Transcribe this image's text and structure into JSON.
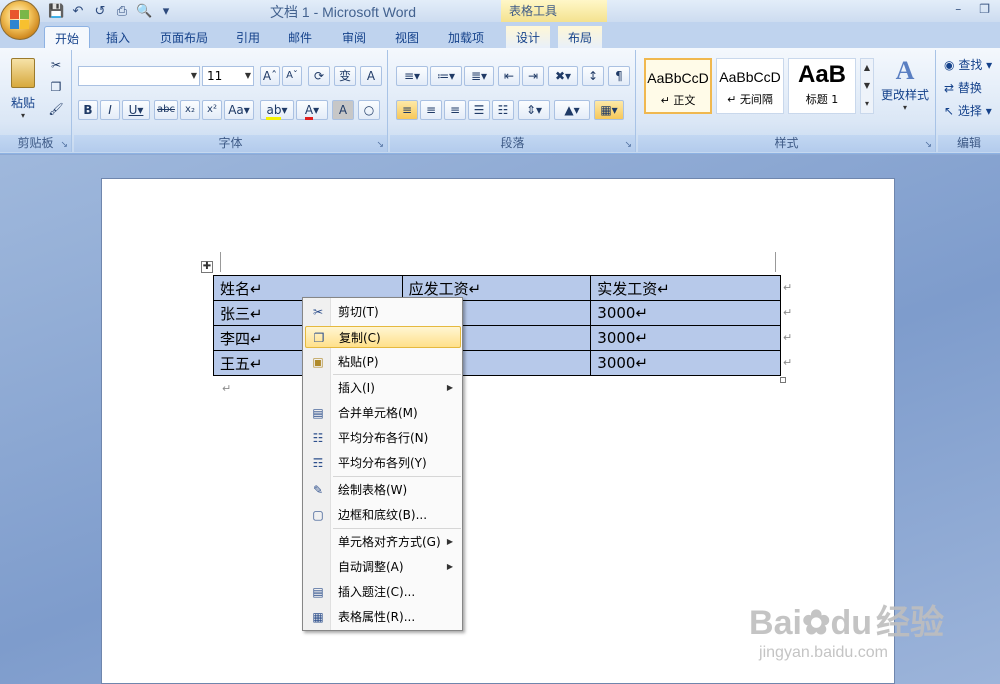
{
  "window": {
    "title": "文档 1 - Microsoft Word",
    "context_tab_group": "表格工具"
  },
  "quick_access": [
    "save-icon",
    "undo-icon",
    "redo-icon",
    "print-icon",
    "print-preview-icon",
    "customize-icon"
  ],
  "tabs": [
    {
      "label": "开始",
      "active": true
    },
    {
      "label": "插入"
    },
    {
      "label": "页面布局"
    },
    {
      "label": "引用"
    },
    {
      "label": "邮件"
    },
    {
      "label": "审阅"
    },
    {
      "label": "视图"
    },
    {
      "label": "加载项"
    },
    {
      "label": "设计"
    },
    {
      "label": "布局"
    }
  ],
  "ribbon": {
    "clipboard": {
      "label": "剪贴板",
      "paste": "粘贴"
    },
    "font": {
      "label": "字体",
      "font_name": "",
      "font_size": "11"
    },
    "paragraph": {
      "label": "段落"
    },
    "styles": {
      "label": "样式",
      "items": [
        {
          "sample": "AaBbCcD",
          "name": "↵ 正文"
        },
        {
          "sample": "AaBbCcD",
          "name": "↵ 无间隔"
        },
        {
          "sample": "AaB",
          "name": "标题 1"
        }
      ],
      "change_styles": "更改样式"
    },
    "editing": {
      "label": "编辑",
      "find": "查找",
      "replace": "替换",
      "select": "选择"
    }
  },
  "table": {
    "headers": [
      "姓名↵",
      "应发工资↵",
      "实发工资↵"
    ],
    "rows": [
      [
        "张三↵",
        "",
        "3000↵"
      ],
      [
        "李四↵",
        "",
        "3000↵"
      ],
      [
        "王五↵",
        "",
        "3000↵"
      ]
    ]
  },
  "context_menu": {
    "items": [
      {
        "label": "剪切(T)",
        "icon": "scissors-icon"
      },
      {
        "label": "复制(C)",
        "icon": "copy-icon",
        "highlighted": true
      },
      {
        "label": "粘贴(P)",
        "icon": "paste-icon"
      },
      {
        "label": "插入(I)",
        "submenu": true
      },
      {
        "label": "合并单元格(M)",
        "icon": "merge-cells-icon"
      },
      {
        "label": "平均分布各行(N)",
        "icon": "distribute-rows-icon"
      },
      {
        "label": "平均分布各列(Y)",
        "icon": "distribute-columns-icon"
      },
      {
        "label": "绘制表格(W)",
        "icon": "draw-table-icon"
      },
      {
        "label": "边框和底纹(B)...",
        "icon": "borders-icon"
      },
      {
        "label": "单元格对齐方式(G)",
        "submenu": true
      },
      {
        "label": "自动调整(A)",
        "submenu": true
      },
      {
        "label": "插入题注(C)...",
        "icon": "caption-icon"
      },
      {
        "label": "表格属性(R)...",
        "icon": "table-properties-icon"
      }
    ]
  },
  "watermark": {
    "brand": "Bai",
    "brand2": "du",
    "cn": "经验",
    "url": "jingyan.baidu.com"
  },
  "colors": {
    "ribbon": "#dbe7f6",
    "selection": "#b7c9ea",
    "menu_highlight": "#ffe08a"
  }
}
